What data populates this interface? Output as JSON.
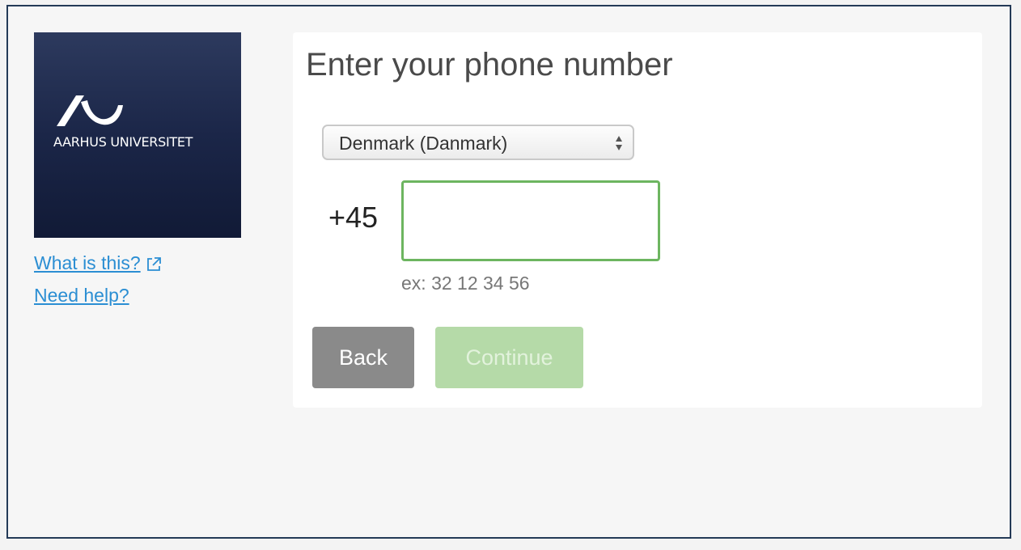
{
  "logo": {
    "text": "AARHUS UNIVERSITET"
  },
  "sidebar": {
    "what_is_this": "What is this?",
    "need_help": "Need help?"
  },
  "form": {
    "title": "Enter your phone number",
    "country_select": {
      "selected": "Denmark (Danmark)"
    },
    "dial_code": "+45",
    "phone_input": {
      "value": "",
      "placeholder": ""
    },
    "hint": "ex: 32 12 34 56",
    "back_label": "Back",
    "continue_label": "Continue"
  },
  "colors": {
    "frame_border": "#243a57",
    "link": "#2b8ed3",
    "input_focus_border": "#6db560",
    "back_button": "#8a8a8a",
    "continue_button_disabled": "#b5daa8"
  },
  "icons": {
    "external_link": "external-link-icon",
    "select_arrows": "sort-arrows-icon"
  }
}
